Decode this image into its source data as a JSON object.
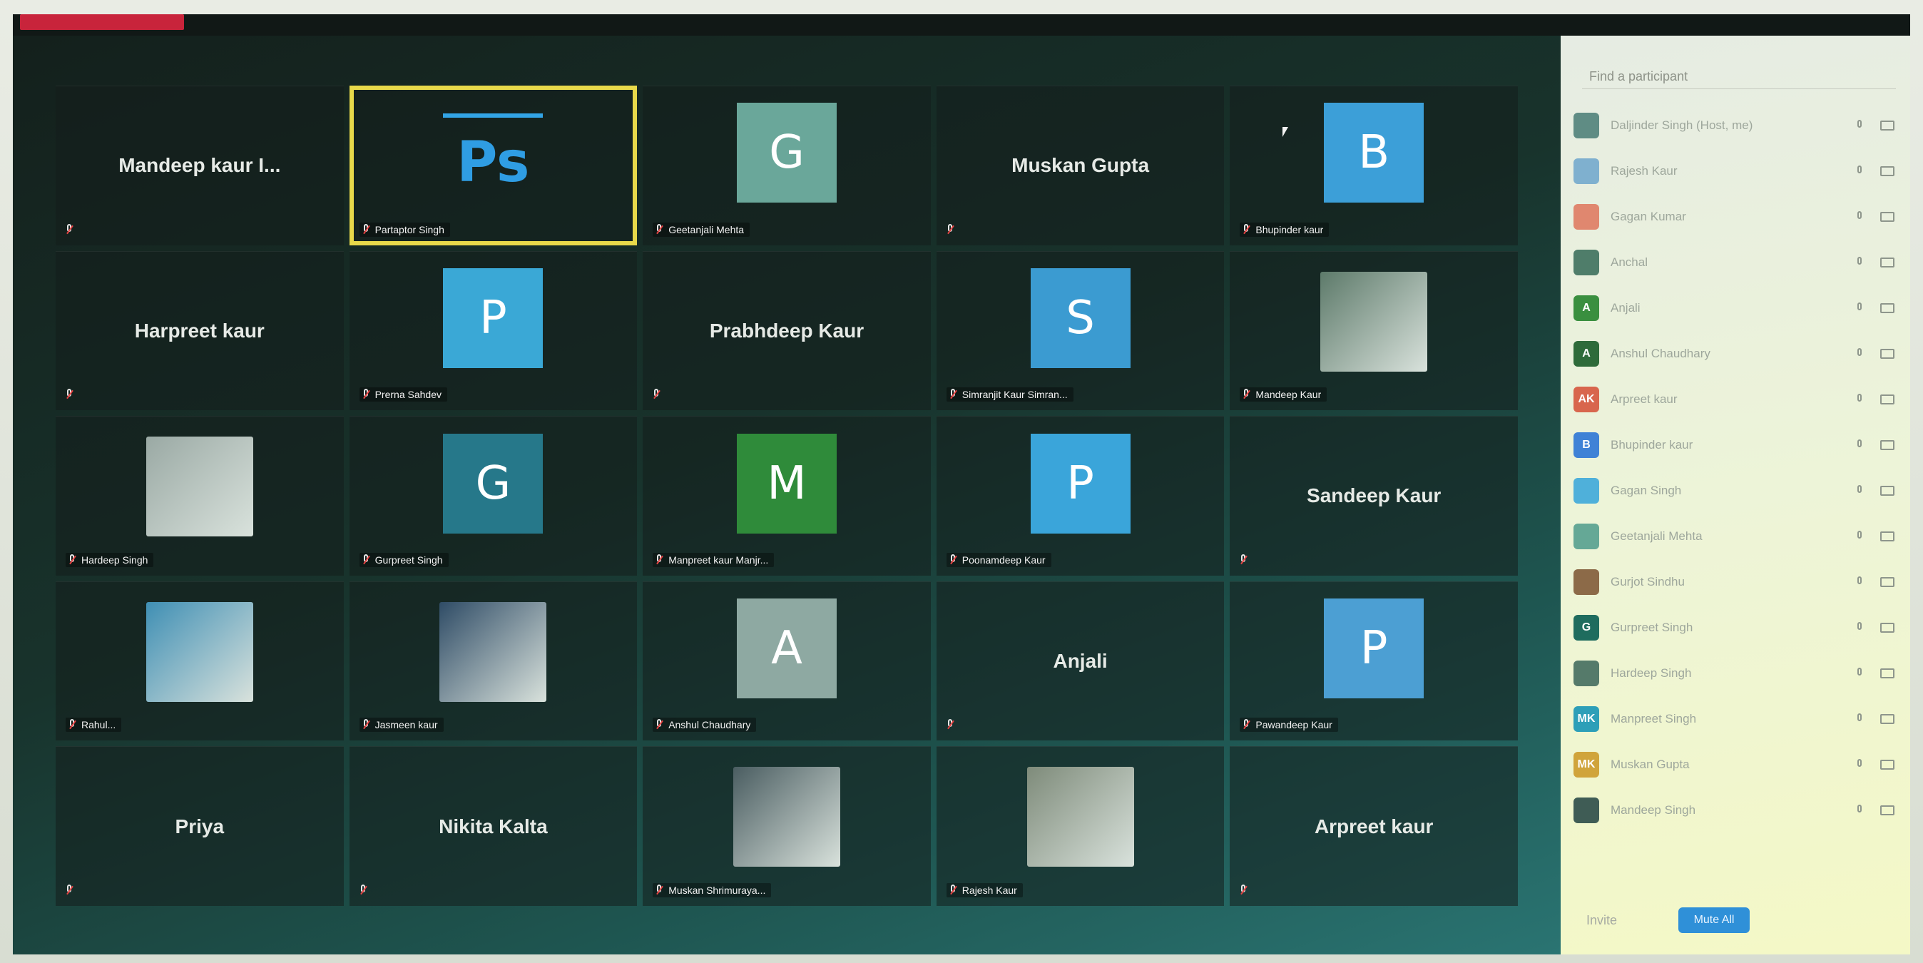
{
  "window": {
    "title": ""
  },
  "gallery": {
    "active_speaker": "Partaptor Singh",
    "tiles": [
      {
        "type": "name",
        "name": "Mandeep kaur I...",
        "caption": ""
      },
      {
        "type": "ps",
        "name": "",
        "caption": "Partaptor Singh",
        "logo_text": "Ps",
        "active": true
      },
      {
        "type": "avatar",
        "name": "",
        "initial": "G",
        "color": "#6aa79a",
        "caption": "Geetanjali Mehta"
      },
      {
        "type": "name",
        "name": "Muskan Gupta",
        "caption": ""
      },
      {
        "type": "avatar",
        "name": "",
        "initial": "B",
        "color": "#3c9fd8",
        "caption": "Bhupinder kaur"
      },
      {
        "type": "name",
        "name": "Harpreet kaur",
        "caption": ""
      },
      {
        "type": "avatar",
        "name": "",
        "initial": "P",
        "color": "#3aa8d6",
        "caption": "Prerna Sahdev"
      },
      {
        "type": "name",
        "name": "Prabhdeep Kaur",
        "caption": ""
      },
      {
        "type": "avatar",
        "name": "",
        "initial": "S",
        "color": "#3b9bd1",
        "caption": "Simranjit Kaur Simran..."
      },
      {
        "type": "photo",
        "name": "",
        "photo": "#5d7a6a",
        "caption": "Mandeep Kaur"
      },
      {
        "type": "photo",
        "name": "",
        "photo": "#9aa9a4",
        "caption": "Hardeep Singh"
      },
      {
        "type": "avatar",
        "name": "",
        "initial": "G",
        "color": "#26788a",
        "caption": "Gurpreet Singh"
      },
      {
        "type": "avatar",
        "name": "",
        "initial": "M",
        "color": "#2f8b3a",
        "caption": "Manpreet kaur Manjr..."
      },
      {
        "type": "avatar",
        "name": "",
        "initial": "P",
        "color": "#3aa5da",
        "caption": "Poonamdeep Kaur"
      },
      {
        "type": "name",
        "name": "Sandeep Kaur",
        "caption": ""
      },
      {
        "type": "photo",
        "name": "",
        "photo": "#3f8fb4",
        "caption": "Rahul..."
      },
      {
        "type": "photo",
        "name": "",
        "photo": "#2f4c66",
        "caption": "Jasmeen kaur"
      },
      {
        "type": "avatar",
        "name": "",
        "initial": "A",
        "color": "#8ea9a2",
        "caption": "Anshul Chaudhary"
      },
      {
        "type": "name",
        "name": "Anjali",
        "caption": ""
      },
      {
        "type": "avatar",
        "name": "",
        "initial": "P",
        "color": "#4c9fd3",
        "caption": "Pawandeep Kaur"
      },
      {
        "type": "name",
        "name": "Priya",
        "caption": ""
      },
      {
        "type": "name",
        "name": "Nikita Kalta",
        "caption": ""
      },
      {
        "type": "photo",
        "name": "",
        "photo": "#4a5d61",
        "caption": "Muskan Shrimuraya..."
      },
      {
        "type": "photo",
        "name": "",
        "photo": "#7e8b7a",
        "caption": "Rajesh Kaur"
      },
      {
        "type": "name",
        "name": "Arpreet kaur",
        "caption": ""
      }
    ]
  },
  "participants_panel": {
    "search_placeholder": "Find a participant",
    "rows": [
      {
        "initial": "",
        "color": "#5f8c84",
        "name": "Daljinder Singh (Host, me)"
      },
      {
        "initial": "",
        "color": "#7fb0cf",
        "name": "Rajesh Kaur"
      },
      {
        "initial": "",
        "color": "#e0876f",
        "name": "Gagan Kumar"
      },
      {
        "initial": "",
        "color": "#4f7d6a",
        "name": "Anchal"
      },
      {
        "initial": "A",
        "color": "#3a8f3f",
        "name": "Anjali"
      },
      {
        "initial": "A",
        "color": "#2e6b3a",
        "name": "Anshul Chaudhary"
      },
      {
        "initial": "AK",
        "color": "#d8664d",
        "name": "Arpreet kaur"
      },
      {
        "initial": "B",
        "color": "#3f82d6",
        "name": "Bhupinder kaur"
      },
      {
        "initial": "",
        "color": "#4fb0da",
        "name": "Gagan Singh"
      },
      {
        "initial": "",
        "color": "#65a896",
        "name": "Geetanjali Mehta"
      },
      {
        "initial": "",
        "color": "#8c6a48",
        "name": "Gurjot Sindhu"
      },
      {
        "initial": "G",
        "color": "#1f6c5e",
        "name": "Gurpreet Singh"
      },
      {
        "initial": "",
        "color": "#557a6a",
        "name": "Hardeep Singh"
      },
      {
        "initial": "MK",
        "color": "#2d9fb8",
        "name": "Manpreet Singh"
      },
      {
        "initial": "MK",
        "color": "#d0a43b",
        "name": "Muskan Gupta"
      },
      {
        "initial": "",
        "color": "#3f5c55",
        "name": "Mandeep Singh"
      }
    ],
    "footer": {
      "invite_label": "Invite",
      "mute_all_label": "Mute All"
    }
  }
}
